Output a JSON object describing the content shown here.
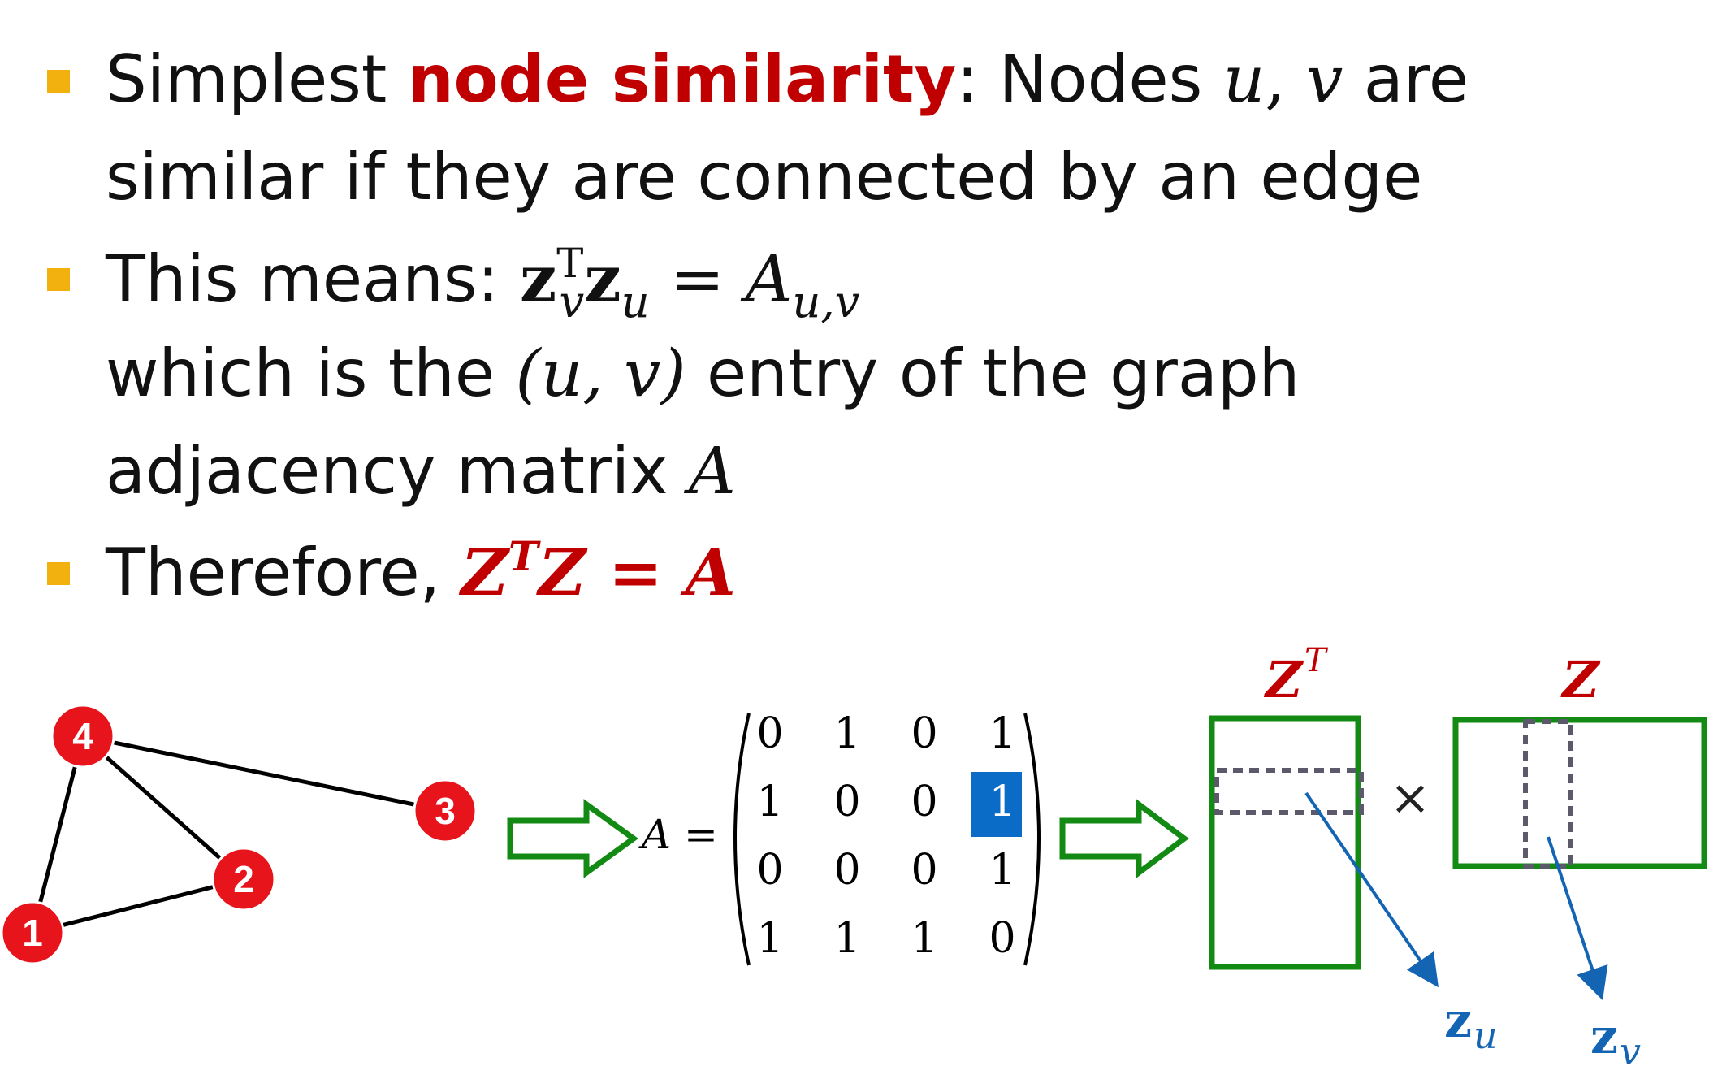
{
  "bullets": {
    "b1": {
      "prefix": "Simplest ",
      "highlight": "node similarity",
      "after": ": Nodes ",
      "var_u": "u",
      "comma": ", ",
      "var_v": "v",
      "suffix": " are",
      "line2": "similar if they are connected by an edge"
    },
    "b2": {
      "prefix": "This means: ",
      "z1": "z",
      "sup1": "T",
      "sub1": "v",
      "z2": "z",
      "sub2": "u",
      "eq": " = ",
      "A": "A",
      "subA": "u,v",
      "line2_pre": "which is the ",
      "line2_math": "(u, v)",
      "line2_post": " entry of the graph",
      "line3_pre": "adjacency matrix ",
      "line3_math": "A"
    },
    "b3": {
      "prefix": "Therefore, ",
      "Z1": "Z",
      "supT": "T",
      "Z2": "Z",
      "eq": " = ",
      "A": "A"
    }
  },
  "graph": {
    "nodes": [
      "1",
      "2",
      "3",
      "4"
    ],
    "edges": [
      [
        "4",
        "3"
      ],
      [
        "4",
        "2"
      ],
      [
        "4",
        "1"
      ],
      [
        "1",
        "2"
      ]
    ]
  },
  "matrix": {
    "label": "A =",
    "rows": [
      [
        "0",
        "1",
        "0",
        "1"
      ],
      [
        "1",
        "0",
        "0",
        "1"
      ],
      [
        "0",
        "0",
        "0",
        "1"
      ],
      [
        "1",
        "1",
        "1",
        "0"
      ]
    ],
    "highlight": {
      "row": 1,
      "col": 3
    }
  },
  "product": {
    "zt_label": "Z",
    "zt_sup": "T",
    "z_label": "Z",
    "times": "×",
    "zu_label": "z",
    "zu_sub": "u",
    "zv_label": "z",
    "zv_sub": "v"
  },
  "colors": {
    "bullet": "#f2b10f",
    "highlight_text": "#c00000",
    "node_fill": "#e8141c",
    "arrow_green": "#138a13",
    "matrix_highlight": "#0a6cc7",
    "pointer_blue": "#1464b4"
  }
}
